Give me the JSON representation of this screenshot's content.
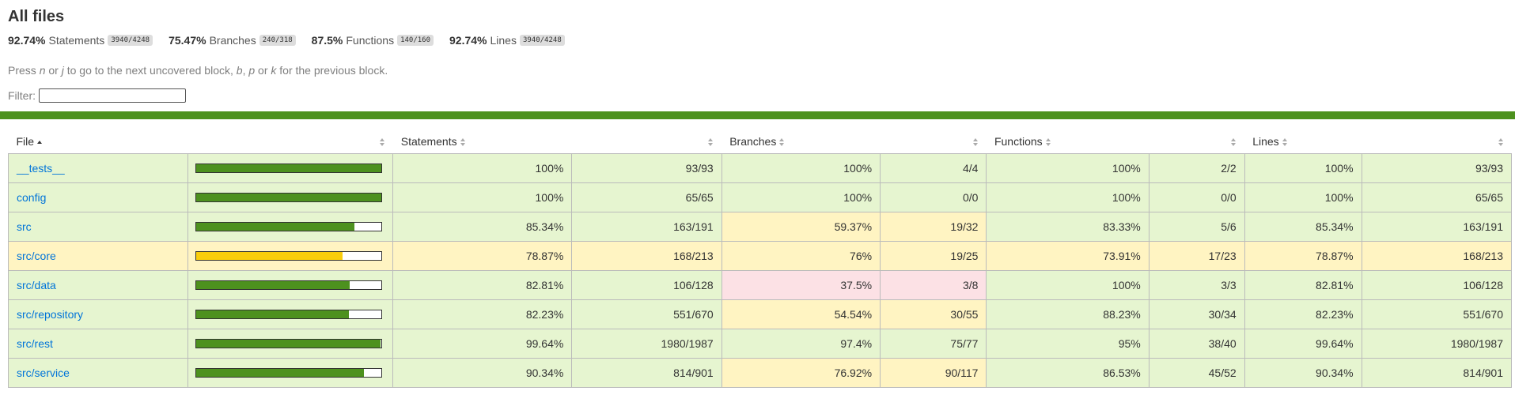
{
  "page": {
    "title": "All files",
    "summary": [
      {
        "pct": "92.74%",
        "label": "Statements",
        "frac": "3940/4248"
      },
      {
        "pct": "75.47%",
        "label": "Branches",
        "frac": "240/318"
      },
      {
        "pct": "87.5%",
        "label": "Functions",
        "frac": "140/160"
      },
      {
        "pct": "92.74%",
        "label": "Lines",
        "frac": "3940/4248"
      }
    ],
    "help": {
      "p1": "Press ",
      "k_n": "n",
      "p2": " or ",
      "k_j": "j",
      "p3": " to go to the next uncovered block, ",
      "k_b": "b",
      "p4": ", ",
      "k_p": "p",
      "p5": " or ",
      "k_k": "k",
      "p6": " for the previous block."
    },
    "filter_label": "Filter:",
    "filter_value": "",
    "status_color": "#4d911e"
  },
  "table": {
    "headers": {
      "file": "File",
      "statements": "Statements",
      "branches": "Branches",
      "functions": "Functions",
      "lines": "Lines"
    },
    "rows": [
      {
        "file": "__tests__",
        "bar_pct": 100,
        "row_level": "high",
        "stmt_pct": "100%",
        "stmt_frac": "93/93",
        "stmt_level": "high",
        "br_pct": "100%",
        "br_frac": "4/4",
        "br_level": "high",
        "fn_pct": "100%",
        "fn_frac": "2/2",
        "fn_level": "high",
        "ln_pct": "100%",
        "ln_frac": "93/93",
        "ln_level": "high"
      },
      {
        "file": "config",
        "bar_pct": 100,
        "row_level": "high",
        "stmt_pct": "100%",
        "stmt_frac": "65/65",
        "stmt_level": "high",
        "br_pct": "100%",
        "br_frac": "0/0",
        "br_level": "high",
        "fn_pct": "100%",
        "fn_frac": "0/0",
        "fn_level": "high",
        "ln_pct": "100%",
        "ln_frac": "65/65",
        "ln_level": "high"
      },
      {
        "file": "src",
        "bar_pct": 85.34,
        "row_level": "high",
        "stmt_pct": "85.34%",
        "stmt_frac": "163/191",
        "stmt_level": "high",
        "br_pct": "59.37%",
        "br_frac": "19/32",
        "br_level": "medium",
        "fn_pct": "83.33%",
        "fn_frac": "5/6",
        "fn_level": "high",
        "ln_pct": "85.34%",
        "ln_frac": "163/191",
        "ln_level": "high"
      },
      {
        "file": "src/core",
        "bar_pct": 78.87,
        "row_level": "medium",
        "stmt_pct": "78.87%",
        "stmt_frac": "168/213",
        "stmt_level": "medium",
        "br_pct": "76%",
        "br_frac": "19/25",
        "br_level": "medium",
        "fn_pct": "73.91%",
        "fn_frac": "17/23",
        "fn_level": "medium",
        "ln_pct": "78.87%",
        "ln_frac": "168/213",
        "ln_level": "medium"
      },
      {
        "file": "src/data",
        "bar_pct": 82.81,
        "row_level": "high",
        "stmt_pct": "82.81%",
        "stmt_frac": "106/128",
        "stmt_level": "high",
        "br_pct": "37.5%",
        "br_frac": "3/8",
        "br_level": "low",
        "fn_pct": "100%",
        "fn_frac": "3/3",
        "fn_level": "high",
        "ln_pct": "82.81%",
        "ln_frac": "106/128",
        "ln_level": "high"
      },
      {
        "file": "src/repository",
        "bar_pct": 82.23,
        "row_level": "high",
        "stmt_pct": "82.23%",
        "stmt_frac": "551/670",
        "stmt_level": "high",
        "br_pct": "54.54%",
        "br_frac": "30/55",
        "br_level": "medium",
        "fn_pct": "88.23%",
        "fn_frac": "30/34",
        "fn_level": "high",
        "ln_pct": "82.23%",
        "ln_frac": "551/670",
        "ln_level": "high"
      },
      {
        "file": "src/rest",
        "bar_pct": 99.64,
        "row_level": "high",
        "stmt_pct": "99.64%",
        "stmt_frac": "1980/1987",
        "stmt_level": "high",
        "br_pct": "97.4%",
        "br_frac": "75/77",
        "br_level": "high",
        "fn_pct": "95%",
        "fn_frac": "38/40",
        "fn_level": "high",
        "ln_pct": "99.64%",
        "ln_frac": "1980/1987",
        "ln_level": "high"
      },
      {
        "file": "src/service",
        "bar_pct": 90.34,
        "row_level": "high",
        "stmt_pct": "90.34%",
        "stmt_frac": "814/901",
        "stmt_level": "high",
        "br_pct": "76.92%",
        "br_frac": "90/117",
        "br_level": "medium",
        "fn_pct": "86.53%",
        "fn_frac": "45/52",
        "fn_level": "high",
        "ln_pct": "90.34%",
        "ln_frac": "814/901",
        "ln_level": "high"
      }
    ]
  }
}
